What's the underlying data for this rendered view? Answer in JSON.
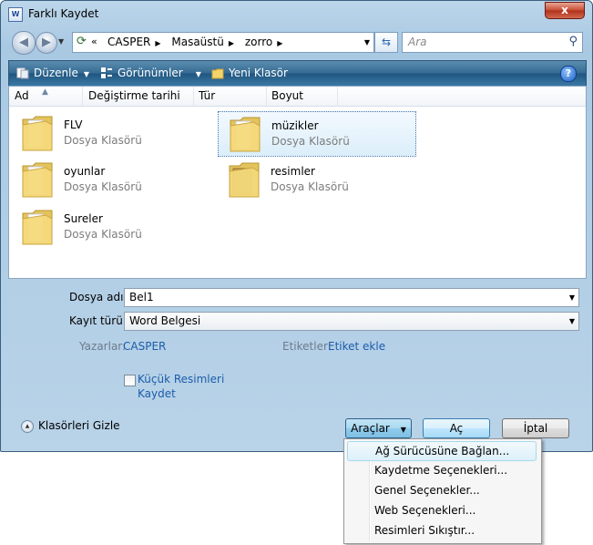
{
  "window": {
    "title": "Farklı Kaydet",
    "close_glyph": "x"
  },
  "address": {
    "prefix": "«",
    "crumbs": [
      "CASPER",
      "Masaüstü",
      "zorro"
    ],
    "search_placeholder": "Ara"
  },
  "toolbar": {
    "organize_label": "Düzenle",
    "views_label": "Görünümler",
    "new_folder_label": "Yeni Klasör",
    "help_glyph": "?"
  },
  "columns": [
    "Ad",
    "Değiştirme tarihi",
    "Tür",
    "Boyut"
  ],
  "files": [
    {
      "name": "FLV",
      "type": "Dosya Klasörü"
    },
    {
      "name": "müzikler",
      "type": "Dosya Klasörü"
    },
    {
      "name": "oyunlar",
      "type": "Dosya Klasörü"
    },
    {
      "name": "resimler",
      "type": "Dosya Klasörü"
    },
    {
      "name": "Sureler",
      "type": "Dosya Klasörü"
    }
  ],
  "form": {
    "filename_label": "Dosya adı:",
    "filename_value": "Bel1",
    "filetype_label": "Kayıt türü:",
    "filetype_value": "Word Belgesi",
    "authors_label": "Yazarlar:",
    "authors_value": "CASPER",
    "tags_label": "Etiketler:",
    "tags_value": "Etiket ekle",
    "thumbnail_line1": "Küçük Resimleri",
    "thumbnail_line2": "Kaydet"
  },
  "footer": {
    "hide_folders": "Klasörleri Gizle",
    "tools_label": "Araçlar",
    "open_label": "Aç",
    "cancel_label": "İptal"
  },
  "tools_menu": [
    "Ağ Sürücüsüne Bağlan...",
    "Kaydetme Seçenekleri...",
    "Genel Seçenekler...",
    "Web Seçenekleri...",
    "Resimleri Sıkıştır..."
  ],
  "colors": {
    "toolbar": "#346a92",
    "link": "#1c5daa",
    "selection": "#dbeefa"
  }
}
